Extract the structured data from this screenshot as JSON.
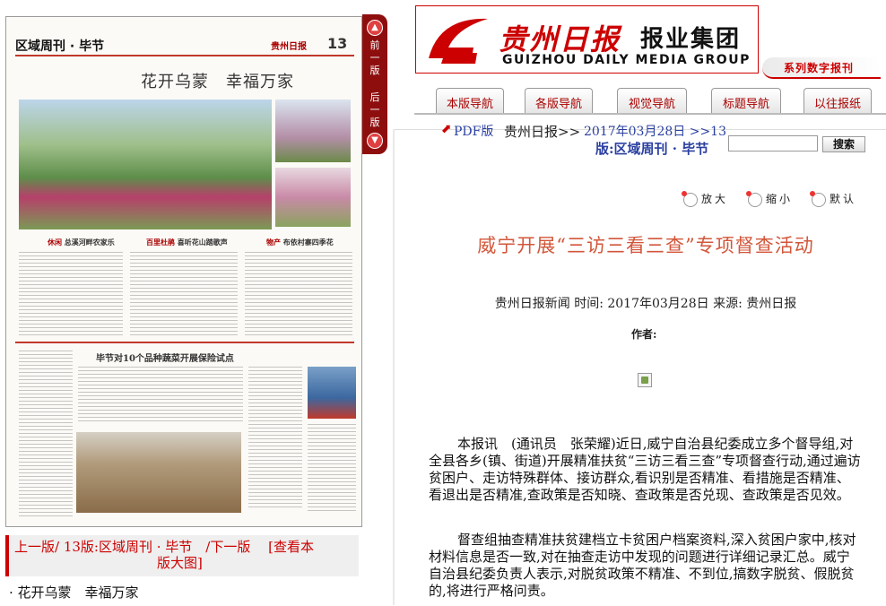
{
  "paper": {
    "header": "区域周刊 · 毕节",
    "logo_text": "贵州日报",
    "page_num": "13",
    "headline": "花开乌蒙　幸福万家",
    "section1": "休闲",
    "section1_text": "总溪河畔农家乐",
    "section2": "百里杜鹃",
    "section2_text": "喜听花山踏歌声",
    "section3": "物产",
    "section3_text": "布依村寨四季花",
    "sub_head": "毕节对10个品种蔬菜开展保险试点"
  },
  "sidetab": {
    "prev": "前一版",
    "next": "后一版"
  },
  "belownav": {
    "line1": "上一版/ 13版:区域周刊 · 毕节　/下一版　 [查看本",
    "line2": "版大图]"
  },
  "article_link": "· 花开乌蒙　幸福万家",
  "brand": {
    "cn_name": "贵州日报",
    "cn_group": "报业集团",
    "en_name": "GUIZHOU DAILY MEDIA GROUP",
    "series": "系列数字报刊"
  },
  "nav": [
    "本版导航",
    "各版导航",
    "视觉导航",
    "标题导航",
    "以往报纸"
  ],
  "crumb": {
    "pdf": "PDF版",
    "paper_name": "贵州日报>>",
    "date": "2017年03月28日  >>13",
    "page": "版:区域周刊 · 毕节"
  },
  "search": {
    "button": "搜索",
    "value": ""
  },
  "zoom": {
    "enlarge": "放大",
    "shrink": "缩小",
    "default": "默认"
  },
  "article": {
    "title": "威宁开展“三访三看三查”专项督查活动",
    "meta": "贵州日报新闻 时间: 2017年03月28日 来源: 贵州日报",
    "author_label": "作者:",
    "paragraphs": [
      "本报讯　(通讯员　张荣耀)近日,威宁自治县纪委成立多个督导组,对全县各乡(镇、街道)开展精准扶贫“三访三看三查”专项督查行动,通过遍访贫困户、走访特殊群体、接访群众,看识别是否精准、看措施是否精准、看退出是否精准,查政策是否知晓、查政策是否兑现、查政策是否见效。",
      "督查组抽查精准扶贫建档立卡贫困户档案资料,深入贫困户家中,核对材料信息是否一致,对在抽查走访中发现的问题进行详细记录汇总。威宁自治县纪委负责人表示,对脱贫政策不精准、不到位,搞数字脱贫、假脱贫的,将进行严格问责。"
    ]
  }
}
